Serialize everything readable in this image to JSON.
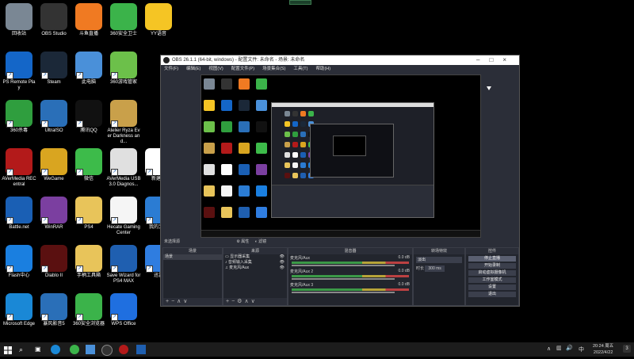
{
  "desktop": {
    "icons": [
      {
        "label": "回收站",
        "color": "#7a8794",
        "col": 0,
        "row": 0
      },
      {
        "label": "OBS Studio",
        "color": "#333333",
        "col": 1,
        "row": 0
      },
      {
        "label": "斗鱼直播",
        "color": "#f07a22",
        "col": 2,
        "row": 0
      },
      {
        "label": "360安全卫士",
        "color": "#3bb34a",
        "col": 3,
        "row": 0
      },
      {
        "label": "YY语音",
        "color": "#f5c524",
        "col": 4,
        "row": 0
      },
      {
        "label": "PS Remote Play",
        "color": "#1466c8",
        "col": 0,
        "row": 1
      },
      {
        "label": "Steam",
        "color": "#1b2838",
        "col": 1,
        "row": 1
      },
      {
        "label": "此电脑",
        "color": "#4a90d9",
        "col": 2,
        "row": 1
      },
      {
        "label": "360游戏管家",
        "color": "#6cc04a",
        "col": 3,
        "row": 1
      },
      {
        "label": "360杀毒",
        "color": "#2f9e3e",
        "col": 0,
        "row": 2
      },
      {
        "label": "UltraISO",
        "color": "#2a6fb8",
        "col": 1,
        "row": 2
      },
      {
        "label": "腾讯QQ",
        "color": "#111111",
        "col": 2,
        "row": 2
      },
      {
        "label": "Atelier Ryza Ever Darkness and...",
        "color": "#c9a04a",
        "col": 3,
        "row": 2
      },
      {
        "label": "AVerMedia RECentral",
        "color": "#b31a1a",
        "col": 0,
        "row": 3
      },
      {
        "label": "WeGame",
        "color": "#d9a520",
        "col": 1,
        "row": 3
      },
      {
        "label": "微信",
        "color": "#3dbb4a",
        "col": 2,
        "row": 3
      },
      {
        "label": "AVerMedia USB3.0 Diagnos...",
        "color": "#e0e0e0",
        "col": 3,
        "row": 3
      },
      {
        "label": "新建文",
        "color": "#ffffff",
        "col": 4,
        "row": 3
      },
      {
        "label": "Battle.net",
        "color": "#1a5fb4",
        "col": 0,
        "row": 4
      },
      {
        "label": "WinRAR",
        "color": "#7b3fa0",
        "col": 1,
        "row": 4
      },
      {
        "label": "PS4",
        "color": "#e8c45a",
        "col": 2,
        "row": 4
      },
      {
        "label": "Hecate Gaming Center",
        "color": "#f5f5f5",
        "col": 3,
        "row": 4
      },
      {
        "label": "我的文档",
        "color": "#2b7cd3",
        "col": 4,
        "row": 4
      },
      {
        "label": "Flash中心",
        "color": "#1a7fe0",
        "col": 0,
        "row": 5
      },
      {
        "label": "Diablo II",
        "color": "#5a1010",
        "col": 1,
        "row": 5
      },
      {
        "label": "手柄工具箱",
        "color": "#e8c45a",
        "col": 2,
        "row": 5
      },
      {
        "label": "Save Wizard for PS4 MAX",
        "color": "#1f5fb0",
        "col": 3,
        "row": 5
      },
      {
        "label": "迅雷",
        "color": "#2f7de0",
        "col": 4,
        "row": 5
      },
      {
        "label": "Microsoft Edge",
        "color": "#1a88d6",
        "col": 0,
        "row": 6
      },
      {
        "label": "暴风影音5",
        "color": "#2a6fb8",
        "col": 1,
        "row": 6
      },
      {
        "label": "360安全浏览器",
        "color": "#3bb34a",
        "col": 2,
        "row": 6
      },
      {
        "label": "WPS Office",
        "color": "#1f6fe0",
        "col": 3,
        "row": 6
      }
    ]
  },
  "obs": {
    "title": "OBS 26.1.1 (64-bit, windows) - 配置文件: 未命名 - 场景: 未命名",
    "menu": [
      "文件(F)",
      "编辑(E)",
      "视图(V)",
      "配置文件(P)",
      "场景集合(S)",
      "工具(T)",
      "帮助(H)"
    ],
    "status_bar": "未选择源",
    "props_label": "属性",
    "filter_label": "滤镜",
    "scenes": {
      "header": "场景",
      "items": [
        "场景"
      ]
    },
    "sources": {
      "header": "来源",
      "items": [
        "显示器采集",
        "音频输入采集",
        "麦克风/Aux"
      ]
    },
    "mixer": {
      "header": "混音器",
      "channels": [
        {
          "name": "麦克风/Aux",
          "db": "0.0 dB"
        },
        {
          "name": "麦克风/Aux 2",
          "db": "0.0 dB"
        },
        {
          "name": "麦克风/Aux 3",
          "db": "0.0 dB"
        }
      ]
    },
    "transitions": {
      "header": "转场特效",
      "type": "淡出",
      "duration_label": "时长",
      "duration": "300 ms"
    },
    "controls": {
      "header": "控件",
      "buttons": [
        "停止直播",
        "开始录制",
        "启动虚拟摄像机",
        "工作室模式",
        "设置",
        "退出"
      ]
    }
  },
  "taskbar": {
    "time": "20:24",
    "weather": "周五",
    "date": "2022/4/22",
    "lang": "中",
    "notify": "3"
  },
  "colors": {
    "accent": "#1a88d6",
    "obs_bg": "#2b2e38"
  }
}
